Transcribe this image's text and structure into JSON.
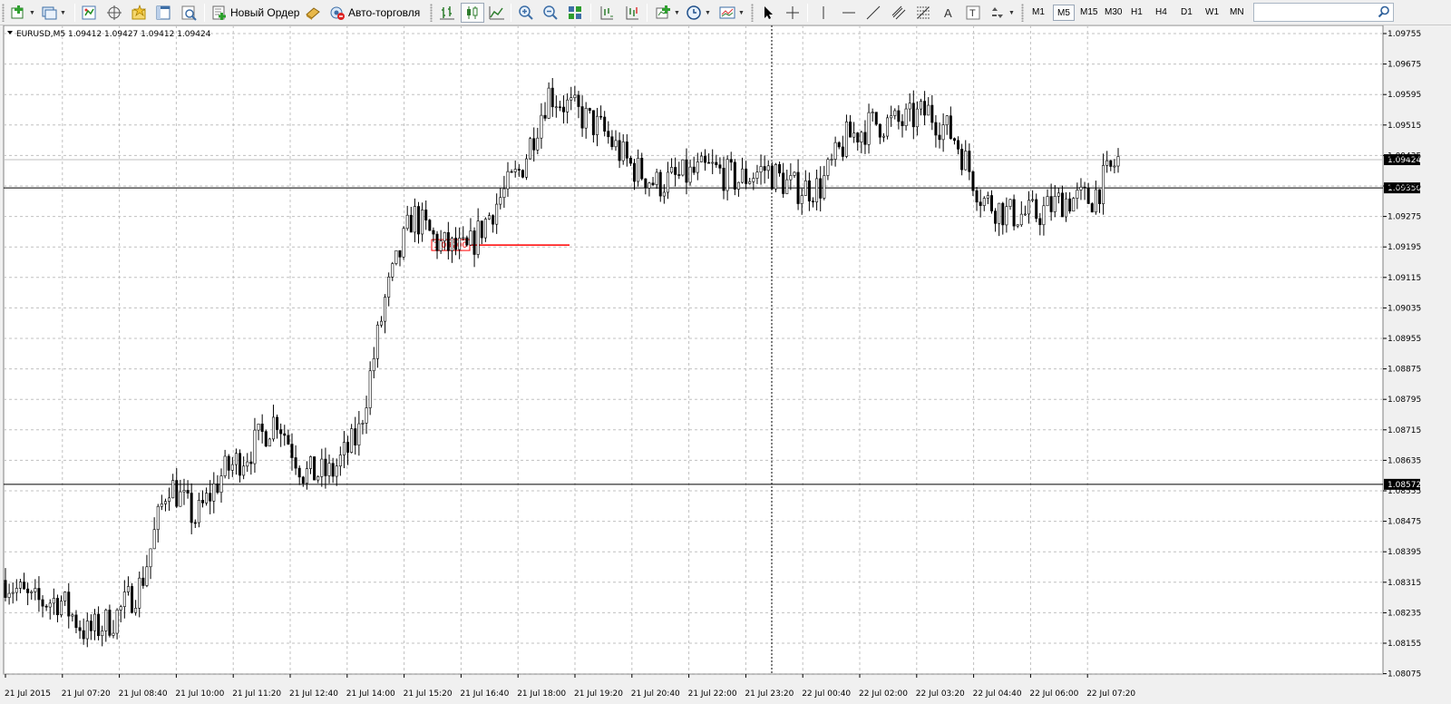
{
  "toolbar": {
    "new_order": "Новый Ордер",
    "auto_trading": "Авто-торговля",
    "timeframes": [
      "M1",
      "M5",
      "M15",
      "M30",
      "H1",
      "H4",
      "D1",
      "W1",
      "MN"
    ],
    "active_timeframe": "M5",
    "search_value": ""
  },
  "chart": {
    "header": "EURUSD,M5  1.09412 1.09427 1.09412 1.09424",
    "price_labels": [
      "1.09755",
      "1.09675",
      "1.09595",
      "1.09515",
      "1.09435",
      "1.09355",
      "1.09275",
      "1.09195",
      "1.09115",
      "1.09035",
      "1.08955",
      "1.08875",
      "1.08795",
      "1.08715",
      "1.08635",
      "1.08555",
      "1.08475",
      "1.08395",
      "1.08315",
      "1.08235",
      "1.08155",
      "1.08075"
    ],
    "time_labels": [
      "21 Jul 2015",
      "21 Jul 07:20",
      "21 Jul 08:40",
      "21 Jul 10:00",
      "21 Jul 11:20",
      "21 Jul 12:40",
      "21 Jul 14:00",
      "21 Jul 15:20",
      "21 Jul 16:40",
      "21 Jul 18:00",
      "21 Jul 19:20",
      "21 Jul 20:40",
      "21 Jul 22:00",
      "21 Jul 23:20",
      "22 Jul 00:40",
      "22 Jul 02:00",
      "22 Jul 03:20",
      "22 Jul 04:40",
      "22 Jul 06:00",
      "22 Jul 07:20"
    ],
    "current_price": "1.09424",
    "hlines": [
      {
        "price": 1.0935,
        "label": "1.09350"
      },
      {
        "price": 1.08572,
        "label": "1.08572"
      }
    ],
    "alert": {
      "price": 1.092,
      "label": "1.09200",
      "color": "#ff0000"
    },
    "colors": {
      "background": "#ffffff",
      "grid": "#c0c0c0",
      "candle": "#000000",
      "alert": "#ff0000"
    }
  },
  "chart_data": {
    "type": "line",
    "title": "EURUSD,M5",
    "ylim": [
      1.08075,
      1.09755
    ],
    "grid": true,
    "x": [
      "21 Jul 2015 06:00",
      "21 Jul 07:20",
      "21 Jul 08:40",
      "21 Jul 09:20",
      "21 Jul 10:00",
      "21 Jul 10:30",
      "21 Jul 11:20",
      "21 Jul 12:00",
      "21 Jul 12:40",
      "21 Jul 14:00",
      "21 Jul 14:40",
      "21 Jul 15:20",
      "21 Jul 15:40",
      "21 Jul 16:10",
      "21 Jul 16:40",
      "21 Jul 17:00",
      "21 Jul 17:40",
      "21 Jul 18:00",
      "21 Jul 18:20",
      "21 Jul 18:50",
      "21 Jul 19:20",
      "21 Jul 19:40",
      "21 Jul 20:40",
      "21 Jul 21:00",
      "21 Jul 22:00",
      "21 Jul 22:40",
      "21 Jul 23:20",
      "22 Jul 00:00",
      "22 Jul 00:40",
      "22 Jul 01:20",
      "22 Jul 02:00",
      "22 Jul 02:20",
      "22 Jul 03:00",
      "22 Jul 03:20",
      "22 Jul 03:40",
      "22 Jul 04:00",
      "22 Jul 04:40",
      "22 Jul 05:20",
      "22 Jul 06:00",
      "22 Jul 06:40",
      "22 Jul 07:20",
      "22 Jul 07:30"
    ],
    "series": [
      {
        "name": "EURUSD,M5",
        "values": [
          1.0832,
          1.0826,
          1.0827,
          1.0818,
          1.0822,
          1.0831,
          1.0858,
          1.0848,
          1.086,
          1.0866,
          1.0875,
          1.086,
          1.086,
          1.087,
          1.0906,
          1.0928,
          1.092,
          1.0918,
          1.093,
          1.094,
          1.096,
          1.0955,
          1.095,
          1.0941,
          1.0936,
          1.0938,
          1.094,
          1.0937,
          1.094,
          1.0935,
          1.0935,
          1.0948,
          1.0952,
          1.0952,
          1.0955,
          1.0948,
          1.0932,
          1.0928,
          1.0928,
          1.0932,
          1.0932,
          1.09424
        ]
      }
    ]
  }
}
